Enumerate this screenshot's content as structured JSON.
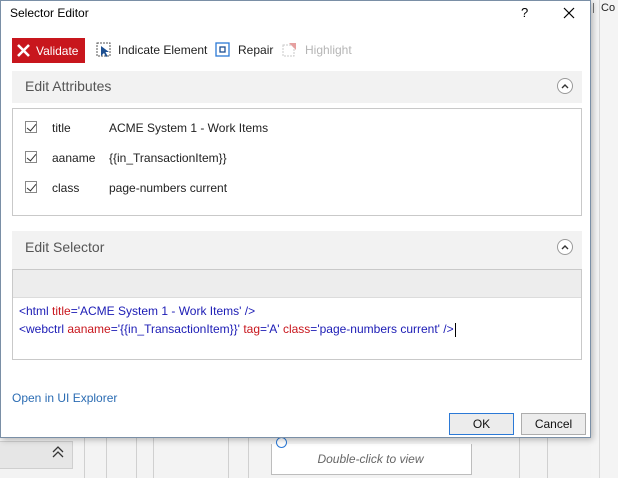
{
  "window": {
    "title": "Selector Editor",
    "help_glyph": "?",
    "close_glyph": "✕"
  },
  "toolbar": {
    "validate_label": "Validate",
    "indicate_label": "Indicate Element",
    "repair_label": "Repair",
    "highlight_label": "Highlight"
  },
  "attributes": {
    "title": "Edit Attributes",
    "rows": [
      {
        "name": "title",
        "value": "ACME System 1 - Work Items",
        "checked": true
      },
      {
        "name": "aaname",
        "value": "{{in_TransactionItem}}",
        "checked": true
      },
      {
        "name": "class",
        "value": "page-numbers current",
        "checked": true
      }
    ]
  },
  "selector": {
    "title": "Edit Selector",
    "line1": {
      "open": "<html ",
      "attr1": "title",
      "eq1": "=",
      "val1": "'ACME System 1 - Work Items'",
      "close": " />"
    },
    "line2": {
      "open": "<webctrl ",
      "attr1": "aaname",
      "eq1": "=",
      "val1": "'{{in_TransactionItem}}'",
      "sp1": " ",
      "attr2": "tag",
      "eq2": "=",
      "val2": "'A'",
      "sp2": " ",
      "attr3": "class",
      "eq3": "=",
      "val3": "'page-numbers current'",
      "close": " />"
    }
  },
  "footer": {
    "open_link": "Open in UI Explorer",
    "ok_label": "OK",
    "cancel_label": "Cancel"
  },
  "background": {
    "right_panel_text": "Co",
    "card_text": "Double-click to view",
    "collapse_glyph": "⋀⋀"
  },
  "colors": {
    "validate_bg": "#c8161d",
    "link": "#2b6cb3",
    "tag": "#1b1bb5",
    "attr": "#c8161d"
  }
}
